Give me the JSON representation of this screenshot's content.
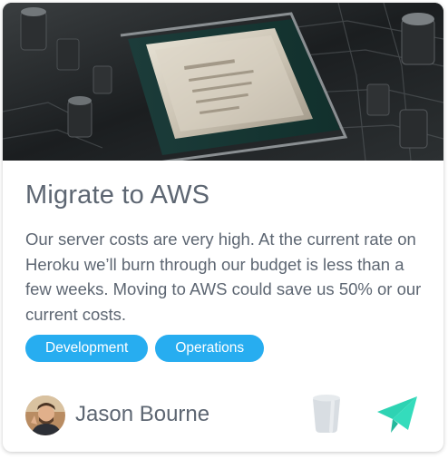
{
  "card": {
    "image": {
      "alt": "CPU on motherboard"
    },
    "title": "Migrate to AWS",
    "description": "Our server costs are very high. At the current rate on Heroku we’ll burn through our budget is less than a few weeks. Moving to AWS could save us 50% or our current costs.",
    "tags": [
      "Development",
      "Operations"
    ],
    "author": {
      "name": "Jason Bourne"
    },
    "actions": {
      "trash_icon": "trash-icon",
      "send_icon": "paper-plane-icon"
    }
  },
  "colors": {
    "tag": "#27adf0",
    "text": "#5d6672",
    "send": "#2ed3b3",
    "trash": "#d8dde2"
  }
}
